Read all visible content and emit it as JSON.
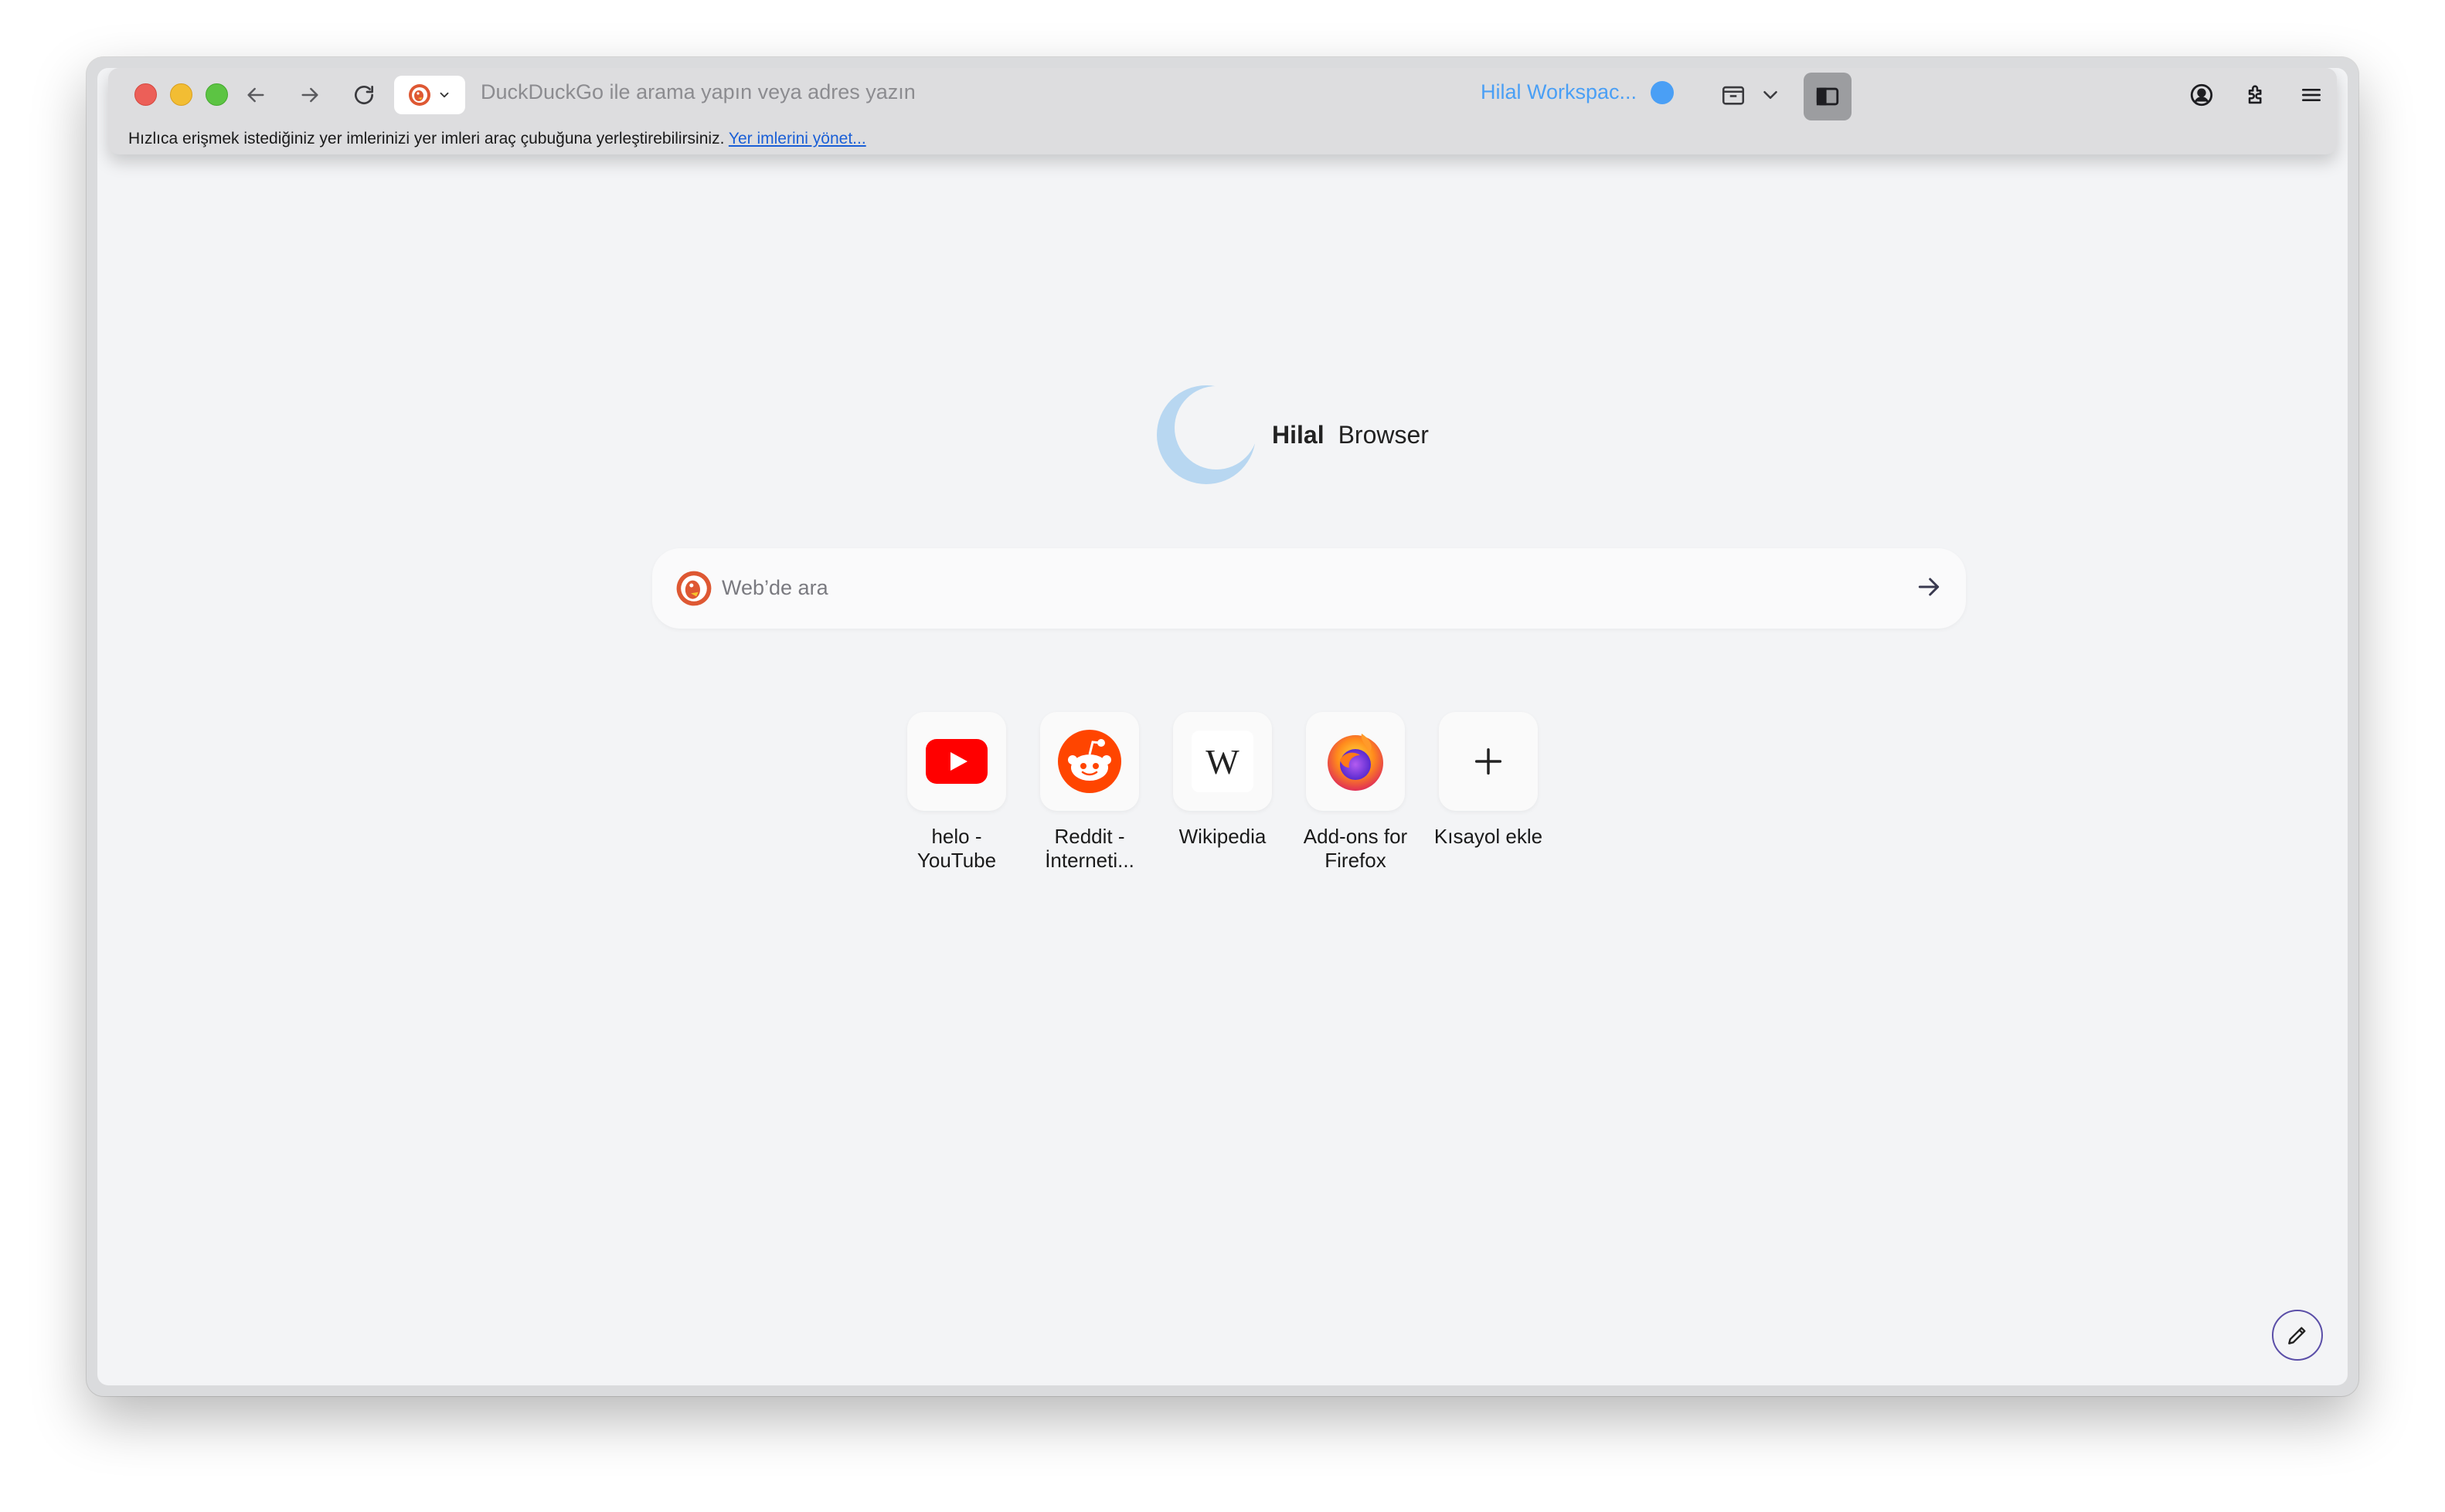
{
  "toolbar": {
    "url_placeholder": "DuckDuckGo ile arama yapın veya adres yazın",
    "workspace_label": "Hilal Workspac..."
  },
  "bookmarks_bar": {
    "message": "Hızlıca erişmek istediğiniz yer imlerinizi yer imleri araç çubuğuna yerleştirebilirsiniz.",
    "manage_link": "Yer imlerini yönet..."
  },
  "brand": {
    "name_bold": "Hilal",
    "name_rest": "Browser"
  },
  "search": {
    "placeholder": "Web’de ara"
  },
  "shortcuts": [
    {
      "line1": "helo -",
      "line2": "YouTube",
      "icon": "youtube-icon"
    },
    {
      "line1": "Reddit -",
      "line2": "İnterneti...",
      "icon": "reddit-icon"
    },
    {
      "line1": "Wikipedia",
      "line2": "",
      "icon": "wikipedia-icon"
    },
    {
      "line1": "Add-ons for",
      "line2": "Firefox",
      "icon": "firefox-icon"
    },
    {
      "line1": "Kısayol ekle",
      "line2": "",
      "icon": "plus-icon"
    }
  ],
  "colors": {
    "accent": "#4a9ff5",
    "link": "#1a5fd6",
    "youtube": "#ff0000",
    "reddit": "#ff4500"
  }
}
